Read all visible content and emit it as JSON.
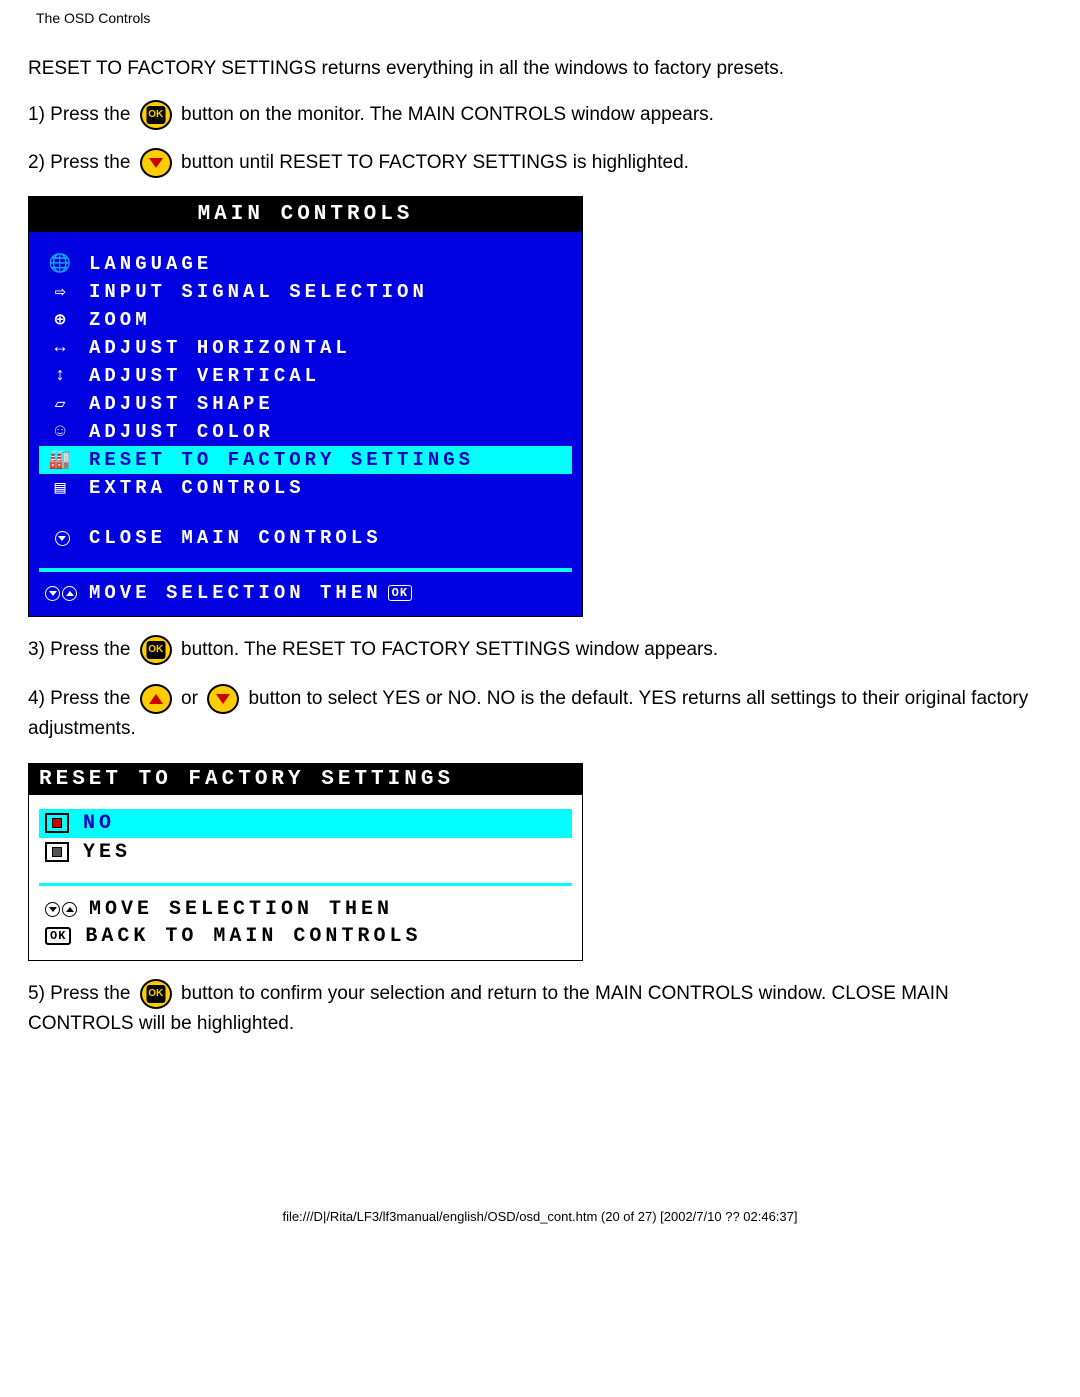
{
  "header": {
    "title": "The OSD Controls"
  },
  "intro": "RESET TO FACTORY SETTINGS returns everything in all the windows to factory presets.",
  "steps": {
    "s1a": "1) Press the ",
    "s1b": " button on the monitor. The MAIN CONTROLS window appears.",
    "s2a": "2) Press the ",
    "s2b": " button until RESET TO FACTORY SETTINGS is highlighted.",
    "s3a": "3) Press the ",
    "s3b": " button. The RESET TO FACTORY SETTINGS window appears.",
    "s4a": "4) Press the ",
    "s4b": " or ",
    "s4c": " button to select YES or NO. NO is the default. YES returns all settings to their original factory adjustments.",
    "s5a": "5) Press the ",
    "s5b": " button to confirm your selection and return to the MAIN CONTROLS window. CLOSE MAIN CONTROLS will be highlighted."
  },
  "osd1": {
    "title": "MAIN CONTROLS",
    "items": [
      {
        "icon": "🌐",
        "label": "LANGUAGE"
      },
      {
        "icon": "⇨",
        "label": "INPUT SIGNAL SELECTION"
      },
      {
        "icon": "⊕",
        "label": "ZOOM"
      },
      {
        "icon": "↔",
        "label": "ADJUST HORIZONTAL"
      },
      {
        "icon": "↕",
        "label": "ADJUST VERTICAL"
      },
      {
        "icon": "▱",
        "label": "ADJUST SHAPE"
      },
      {
        "icon": "☺",
        "label": "ADJUST COLOR"
      },
      {
        "icon": "🏭",
        "label": "RESET TO FACTORY SETTINGS"
      },
      {
        "icon": "▤",
        "label": "EXTRA CONTROLS"
      }
    ],
    "close": "CLOSE MAIN CONTROLS",
    "footer": "MOVE SELECTION THEN",
    "ok": "OK"
  },
  "osd2": {
    "title": "RESET TO FACTORY SETTINGS",
    "no": "NO",
    "yes": "YES",
    "f1": "MOVE SELECTION THEN",
    "f2": "BACK TO MAIN CONTROLS",
    "ok": "OK"
  },
  "footerPath": "file:///D|/Rita/LF3/lf3manual/english/OSD/osd_cont.htm (20 of 27) [2002/7/10 ?? 02:46:37]"
}
